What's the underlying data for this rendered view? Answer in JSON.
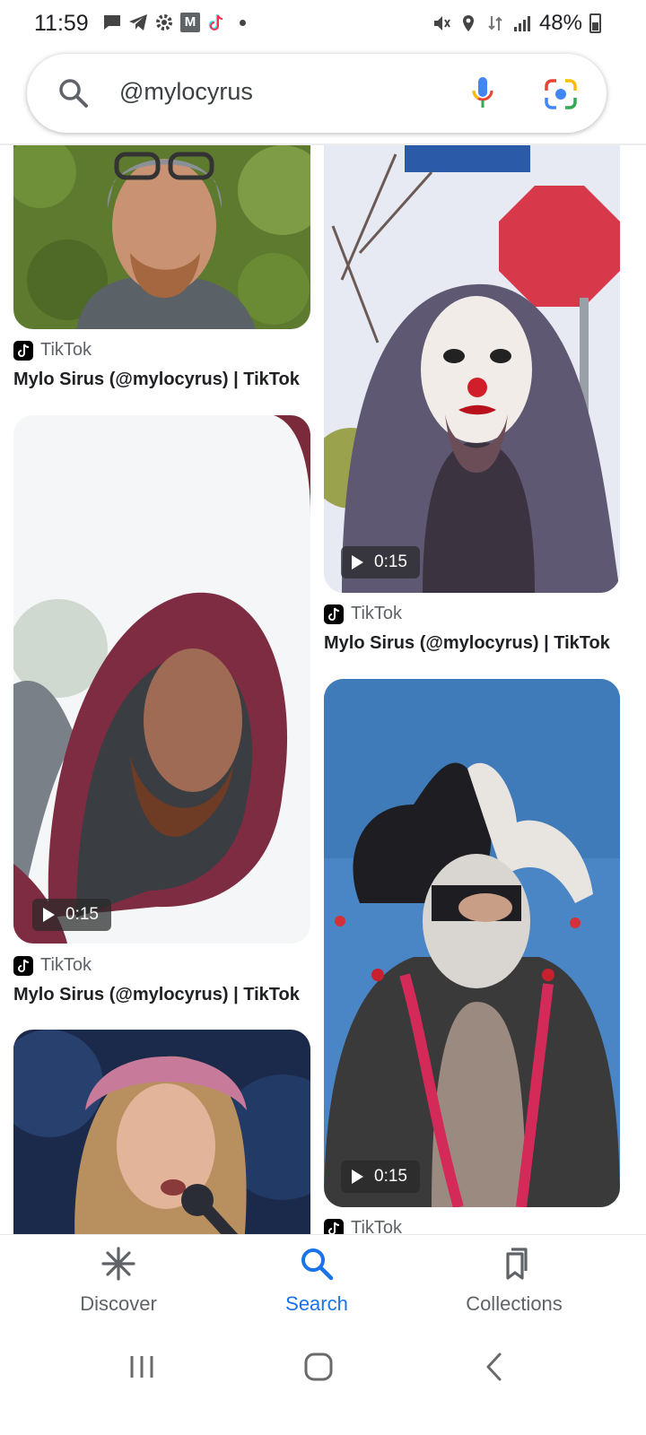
{
  "status_bar": {
    "time": "11:59",
    "battery": "48%",
    "left_icons": [
      "message-icon",
      "telegram-icon",
      "settings-icon",
      "gmail-icon",
      "tiktok-icon",
      "dot-icon"
    ],
    "right_icons": [
      "mute-icon",
      "location-icon",
      "data-icon",
      "signal-icon",
      "battery-icon"
    ]
  },
  "search": {
    "query": "@mylocyrus",
    "icons": [
      "search-icon",
      "mic-icon",
      "lens-icon"
    ]
  },
  "results": {
    "left": [
      {
        "source": "TikTok",
        "title": "Mylo Sirus (@mylocyrus) | TikTok",
        "duration": ""
      },
      {
        "source": "TikTok",
        "title": "Mylo Sirus (@mylocyrus) | TikTok",
        "duration": "0:15"
      },
      {
        "source": "",
        "title": "",
        "duration": ""
      }
    ],
    "right": [
      {
        "source": "TikTok",
        "title": "Mylo Sirus (@mylocyrus) | TikTok",
        "duration": "0:15"
      },
      {
        "source": "TikTok",
        "title": "",
        "duration": "0:15"
      }
    ]
  },
  "bottom_nav": {
    "items": [
      {
        "label": "Discover",
        "icon": "asterisk-icon",
        "active": false
      },
      {
        "label": "Search",
        "icon": "search-icon",
        "active": true
      },
      {
        "label": "Collections",
        "icon": "bookmarks-icon",
        "active": false
      }
    ]
  },
  "system_nav": {
    "buttons": [
      "recents-button",
      "home-button",
      "back-button"
    ]
  },
  "colors": {
    "accent": "#1a73e8",
    "text": "#202124",
    "secondary": "#5f6368"
  }
}
